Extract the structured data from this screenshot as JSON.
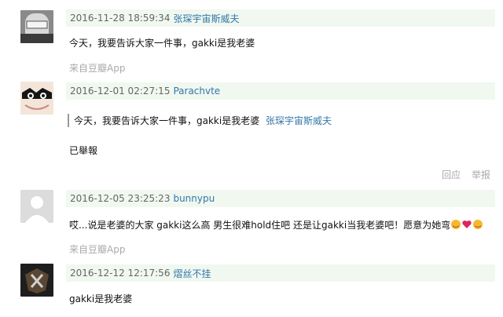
{
  "comments": [
    {
      "time": "2016-11-28 18:59:34",
      "user": "张琛宇宙斯威夫",
      "text": "今天，我要告诉大家一件事，gakki是我老婆",
      "source": "来自豆瓣App"
    },
    {
      "time": "2016-12-01 02:27:15",
      "user": "Parachvte",
      "quote_text": "今天，我要告诉大家一件事，gakki是我老婆",
      "quote_user": "张琛宇宙斯威夫",
      "text": "已舉報",
      "reply_label": "回应",
      "report_label": "举报"
    },
    {
      "time": "2016-12-05 23:25:23",
      "user": "bunnypu",
      "text": "哎...说是老婆的大家 gakki这么高 男生很难hold住吧 还是让gakki当我老婆吧！愿意为她弯",
      "emojis": [
        "bowing-emoji",
        "red-heart-emoji",
        "bowing-emoji"
      ],
      "source": "来自豆瓣App"
    },
    {
      "time": "2016-12-12 12:17:56",
      "user": "熠丝不挂",
      "text": "gakki是我老婆"
    }
  ]
}
